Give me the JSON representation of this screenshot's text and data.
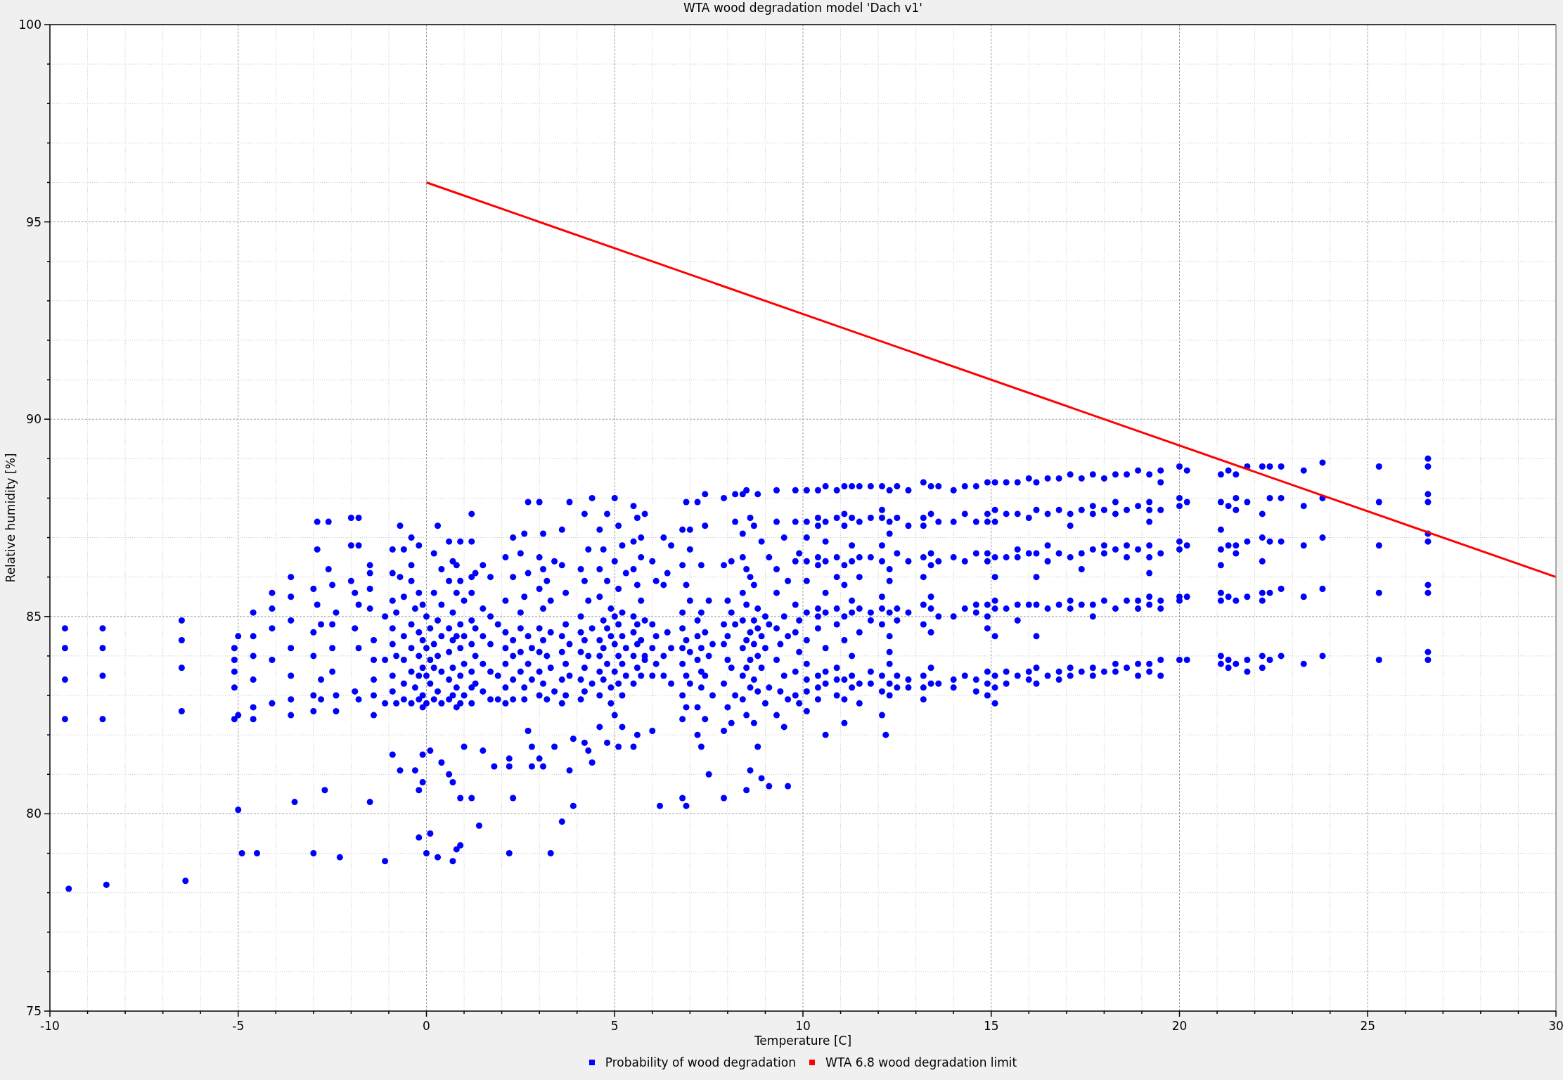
{
  "chart": {
    "chart_data": {
      "type": "scatter",
      "title": "WTA wood degradation model 'Dach v1'",
      "xlabel": "Temperature [C]",
      "ylabel": "Relative humidity [%]",
      "xlim": [
        -10,
        30
      ],
      "ylim": [
        75,
        100
      ],
      "xticks": [
        -10,
        -5,
        0,
        5,
        10,
        15,
        20,
        25,
        30
      ],
      "yticks": [
        75,
        80,
        85,
        90,
        95,
        100
      ],
      "grid": true,
      "series": [
        {
          "name": "Probability of wood degradation",
          "color": "#0000ff",
          "type": "scatter",
          "x": [
            -9.6,
            -9.6,
            -9.6,
            -9.6,
            -9.5,
            -8.6,
            -8.6,
            -8.6,
            -8.6,
            -8.5,
            -6.5,
            -6.5,
            -6.5,
            -6.5,
            -6.4,
            -5.1,
            -5.1,
            -5.1,
            -5.1,
            -5.1,
            -5.0,
            -5.0,
            -5.0,
            -4.9,
            -4.6,
            -4.6,
            -4.6,
            -4.6,
            -4.6,
            -4.6,
            -4.5,
            -4.1,
            -4.1,
            -4.1,
            -4.1,
            -4.1,
            -3.6,
            -3.6,
            -3.6,
            -3.6,
            -3.6,
            -3.6,
            -3.6,
            -3.5,
            -3.0,
            -3.0,
            -3.0,
            -3.0,
            -3.0,
            -3.0,
            -2.9,
            -2.9,
            -2.9,
            -2.8,
            -2.8,
            -2.8,
            -2.7,
            -2.6,
            -2.6,
            -2.5,
            -2.5,
            -2.5,
            -2.5,
            -2.4,
            -2.4,
            -2.4,
            -2.3,
            -2.0,
            -2.0,
            -2.0,
            -1.9,
            -1.9,
            -1.9,
            -1.8,
            -1.8,
            -1.8,
            -1.8,
            -1.8,
            -1.5,
            -1.5,
            -1.5,
            -1.5,
            -1.4,
            -1.4,
            -1.4,
            -1.4,
            -1.4,
            -1.5,
            -1.1,
            -1.1,
            -1.1,
            -1.1,
            -0.9,
            -0.9,
            -0.9,
            -0.9,
            -0.9,
            -0.9,
            -0.9,
            -0.9,
            -0.8,
            -0.8,
            -0.8,
            -0.7,
            -0.7,
            -0.7,
            -0.6,
            -0.6,
            -0.6,
            -0.6,
            -0.6,
            -0.6,
            -0.4,
            -0.4,
            -0.4,
            -0.4,
            -0.4,
            -0.4,
            -0.4,
            -0.3,
            -0.3,
            -0.3,
            -0.2,
            -0.2,
            -0.2,
            -0.2,
            -0.2,
            -0.2,
            -0.2,
            -0.2,
            -0.1,
            -0.1,
            -0.1,
            -0.1,
            -0.1,
            -0.1,
            -0.1,
            0.0,
            0.0,
            0.0,
            0.0,
            0.0,
            0.1,
            0.1,
            0.1,
            0.1,
            0.1,
            0.2,
            0.2,
            0.2,
            0.2,
            0.2,
            0.3,
            0.3,
            0.3,
            0.3,
            0.3,
            0.4,
            0.4,
            0.4,
            0.4,
            0.4,
            0.4,
            0.6,
            0.6,
            0.6,
            0.6,
            0.6,
            0.6,
            0.6,
            0.7,
            0.7,
            0.7,
            0.7,
            0.7,
            0.7,
            0.7,
            0.8,
            0.8,
            0.8,
            0.8,
            0.8,
            0.8,
            0.9,
            0.9,
            0.9,
            0.9,
            0.9,
            0.9,
            0.9,
            0.9,
            1.0,
            1.0,
            1.0,
            1.0,
            1.0,
            1.2,
            1.2,
            1.2,
            1.2,
            1.2,
            1.2,
            1.2,
            1.2,
            1.2,
            1.2,
            1.3,
            1.3,
            1.3,
            1.3,
            1.5,
            1.5,
            1.5,
            1.5,
            1.5,
            1.5,
            1.4,
            1.7,
            1.7,
            1.7,
            1.7,
            1.7,
            1.8,
            1.9,
            1.9,
            1.9,
            2.1,
            2.1,
            2.1,
            2.1,
            2.1,
            2.1,
            2.1,
            2.2,
            2.2,
            2.2,
            2.3,
            2.3,
            2.3,
            2.3,
            2.3,
            2.3,
            2.3,
            2.5,
            2.5,
            2.5,
            2.5,
            2.5,
            2.6,
            2.6,
            2.6,
            2.6,
            2.7,
            2.7,
            2.7,
            2.7,
            2.7,
            2.8,
            2.8,
            2.8,
            2.8,
            3.0,
            3.0,
            3.0,
            3.0,
            3.0,
            3.0,
            3.0,
            3.0,
            3.1,
            3.1,
            3.1,
            3.1,
            3.1,
            3.1,
            3.2,
            3.2,
            3.2,
            3.3,
            3.3,
            3.3,
            3.3,
            3.4,
            3.4,
            3.4,
            3.6,
            3.6,
            3.6,
            3.6,
            3.6,
            3.6,
            3.6,
            3.7,
            3.7,
            3.7,
            3.7,
            3.8,
            3.8,
            3.8,
            3.8,
            3.9,
            3.9,
            4.1,
            4.1,
            4.1,
            4.1,
            4.1,
            4.1,
            4.2,
            4.2,
            4.2,
            4.2,
            4.2,
            4.2,
            4.3,
            4.3,
            4.3,
            4.3,
            4.4,
            4.4,
            4.4,
            4.4,
            4.6,
            4.6,
            4.6,
            4.6,
            4.6,
            4.6,
            4.6,
            4.6,
            4.7,
            4.7,
            4.7,
            4.7,
            4.8,
            4.8,
            4.8,
            4.8,
            4.8,
            4.9,
            4.9,
            4.9,
            4.9,
            5.0,
            5.0,
            5.0,
            5.0,
            5.0,
            5.0,
            5.1,
            5.1,
            5.1,
            5.1,
            5.1,
            5.1,
            5.2,
            5.2,
            5.2,
            5.2,
            5.2,
            5.2,
            5.3,
            5.3,
            5.3,
            5.5,
            5.5,
            5.5,
            5.5,
            5.5,
            5.5,
            5.5,
            5.5,
            5.6,
            5.6,
            5.6,
            5.6,
            5.6,
            5.6,
            5.7,
            5.7,
            5.7,
            5.7,
            5.7,
            5.8,
            5.8,
            5.8,
            5.8,
            6.0,
            6.0,
            6.0,
            6.0,
            6.0,
            6.1,
            6.1,
            6.1,
            6.2,
            6.3,
            6.3,
            6.3,
            6.3,
            6.4,
            6.4,
            6.5,
            6.5,
            6.5,
            6.8,
            6.8,
            6.8,
            6.8,
            6.8,
            6.8,
            6.8,
            6.8,
            6.8,
            6.9,
            6.9,
            6.9,
            6.9,
            6.9,
            6.9,
            7.0,
            7.0,
            7.0,
            7.0,
            7.0,
            7.2,
            7.2,
            7.2,
            7.2,
            7.2,
            7.2,
            7.3,
            7.3,
            7.3,
            7.3,
            7.3,
            7.3,
            7.4,
            7.4,
            7.4,
            7.4,
            7.4,
            7.5,
            7.5,
            7.5,
            7.6,
            7.6,
            7.9,
            7.9,
            7.9,
            7.9,
            7.9,
            7.9,
            7.9,
            8.0,
            8.0,
            8.0,
            8.0,
            8.1,
            8.1,
            8.1,
            8.1,
            8.2,
            8.2,
            8.2,
            8.2,
            8.4,
            8.4,
            8.4,
            8.4,
            8.4,
            8.4,
            8.4,
            8.4,
            8.5,
            8.5,
            8.5,
            8.5,
            8.5,
            8.5,
            8.5,
            8.6,
            8.6,
            8.6,
            8.6,
            8.6,
            8.6,
            8.7,
            8.7,
            8.7,
            8.7,
            8.7,
            8.7,
            8.8,
            8.8,
            8.8,
            8.8,
            8.8,
            8.8,
            8.9,
            8.9,
            8.9,
            8.9,
            9.0,
            9.0,
            9.0,
            9.1,
            9.1,
            9.1,
            9.1,
            9.3,
            9.3,
            9.3,
            9.3,
            9.3,
            9.3,
            9.3,
            9.4,
            9.4,
            9.5,
            9.5,
            9.5,
            9.5,
            9.6,
            9.6,
            9.6,
            9.6,
            9.8,
            9.8,
            9.8,
            9.8,
            9.8,
            9.8,
            9.8,
            9.9,
            9.9,
            9.9,
            9.9,
            10.1,
            10.1,
            10.1,
            10.1,
            10.1,
            10.1,
            10.1,
            10.1,
            10.1,
            10.1,
            10.1,
            10.4,
            10.4,
            10.4,
            10.4,
            10.4,
            10.4,
            10.4,
            10.4,
            10.4,
            10.4,
            10.4,
            10.6,
            10.6,
            10.6,
            10.6,
            10.6,
            10.6,
            10.6,
            10.6,
            10.6,
            10.6,
            10.9,
            10.9,
            10.9,
            10.9,
            10.9,
            10.9,
            10.9,
            10.9,
            10.9,
            11.1,
            11.1,
            11.1,
            11.1,
            11.1,
            11.1,
            11.1,
            11.1,
            11.1,
            11.1,
            11.3,
            11.3,
            11.3,
            11.3,
            11.3,
            11.3,
            11.3,
            11.3,
            11.3,
            11.5,
            11.5,
            11.5,
            11.5,
            11.5,
            11.5,
            11.5,
            11.5,
            11.8,
            11.8,
            11.8,
            11.8,
            11.8,
            11.8,
            11.8,
            12.1,
            12.1,
            12.1,
            12.1,
            12.1,
            12.1,
            12.1,
            12.1,
            12.1,
            12.1,
            12.1,
            12.3,
            12.3,
            12.3,
            12.3,
            12.3,
            12.3,
            12.3,
            12.3,
            12.3,
            12.3,
            12.3,
            12.2,
            12.5,
            12.5,
            12.5,
            12.5,
            12.5,
            12.5,
            12.5,
            12.8,
            12.8,
            12.8,
            12.8,
            12.8,
            12.8,
            13.2,
            13.2,
            13.2,
            13.2,
            13.2,
            13.2,
            13.2,
            13.2,
            13.2,
            13.2,
            13.4,
            13.4,
            13.4,
            13.4,
            13.4,
            13.4,
            13.4,
            13.4,
            13.4,
            13.6,
            13.6,
            13.6,
            13.6,
            13.6,
            14.0,
            14.0,
            14.0,
            14.0,
            14.0,
            14.0,
            14.3,
            14.3,
            14.3,
            14.3,
            14.3,
            14.6,
            14.6,
            14.6,
            14.6,
            14.6,
            14.6,
            14.6,
            14.9,
            14.9,
            14.9,
            14.9,
            14.9,
            14.9,
            14.9,
            14.9,
            14.9,
            14.9,
            14.9,
            15.1,
            15.1,
            15.1,
            15.1,
            15.1,
            15.1,
            15.1,
            15.1,
            15.1,
            15.1,
            15.1,
            15.4,
            15.4,
            15.4,
            15.4,
            15.4,
            15.4,
            15.7,
            15.7,
            15.7,
            15.7,
            15.7,
            15.7,
            15.7,
            16.0,
            16.0,
            16.0,
            16.0,
            16.0,
            16.0,
            16.2,
            16.2,
            16.2,
            16.2,
            16.2,
            16.2,
            16.2,
            16.2,
            16.5,
            16.5,
            16.5,
            16.5,
            16.5,
            16.5,
            16.8,
            16.8,
            16.8,
            16.8,
            16.8,
            16.8,
            17.1,
            17.1,
            17.1,
            17.1,
            17.1,
            17.1,
            17.1,
            17.1,
            17.4,
            17.4,
            17.4,
            17.4,
            17.4,
            17.4,
            17.7,
            17.7,
            17.7,
            17.7,
            17.7,
            17.7,
            17.7,
            17.7,
            18.0,
            18.0,
            18.0,
            18.0,
            18.0,
            18.0,
            18.3,
            18.3,
            18.3,
            18.3,
            18.3,
            18.3,
            18.3,
            18.6,
            18.6,
            18.6,
            18.6,
            18.6,
            18.6,
            18.9,
            18.9,
            18.9,
            18.9,
            18.9,
            18.9,
            18.9,
            19.2,
            19.2,
            19.2,
            19.2,
            19.2,
            19.2,
            19.2,
            19.2,
            19.2,
            19.2,
            19.2,
            19.5,
            19.5,
            19.5,
            19.5,
            19.5,
            19.5,
            19.5,
            19.5,
            20.0,
            20.0,
            20.0,
            20.0,
            20.0,
            20.0,
            20.0,
            20.0,
            20.2,
            20.2,
            20.2,
            20.2,
            20.2,
            21.1,
            21.1,
            21.1,
            21.1,
            21.1,
            21.1,
            21.1,
            21.1,
            21.1,
            21.3,
            21.3,
            21.3,
            21.3,
            21.3,
            21.3,
            21.5,
            21.5,
            21.5,
            21.5,
            21.5,
            21.5,
            21.5,
            21.8,
            21.8,
            21.8,
            21.8,
            21.8,
            21.8,
            22.2,
            22.2,
            22.2,
            22.2,
            22.2,
            22.2,
            22.2,
            22.2,
            22.4,
            22.4,
            22.4,
            22.4,
            22.4,
            22.7,
            22.7,
            22.7,
            22.7,
            22.7,
            23.3,
            23.3,
            23.3,
            23.3,
            23.3,
            23.8,
            23.8,
            23.8,
            23.8,
            23.8,
            25.3,
            25.3,
            25.3,
            25.3,
            25.3,
            26.6,
            26.6,
            26.6,
            26.6,
            26.6,
            26.6,
            26.6,
            26.6,
            26.6,
            26.6
          ],
          "values": [
            84.7,
            84.2,
            83.4,
            82.4,
            78.1,
            84.7,
            84.2,
            83.5,
            82.4,
            78.2,
            84.9,
            84.4,
            83.7,
            82.6,
            78.3,
            84.2,
            83.9,
            83.6,
            83.2,
            82.4,
            84.5,
            82.5,
            80.1,
            79.0,
            85.1,
            84.5,
            84.0,
            83.4,
            82.7,
            82.4,
            79.0,
            85.6,
            85.2,
            84.7,
            83.9,
            82.8,
            86.0,
            85.5,
            84.9,
            84.2,
            83.5,
            82.9,
            82.5,
            80.3,
            85.7,
            84.6,
            84.0,
            83.0,
            82.6,
            79.0,
            87.4,
            86.7,
            85.3,
            84.8,
            83.4,
            82.9,
            80.6,
            87.4,
            86.2,
            85.8,
            84.8,
            84.2,
            83.6,
            85.1,
            83.0,
            82.6,
            78.9,
            87.5,
            86.8,
            85.9,
            85.6,
            84.7,
            83.1,
            87.5,
            86.8,
            85.3,
            84.2,
            82.9,
            86.3,
            86.1,
            85.7,
            85.2,
            84.4,
            83.9,
            83.4,
            83.0,
            82.5,
            80.3,
            85.0,
            83.9,
            82.8,
            78.8,
            86.7,
            86.1,
            85.4,
            84.7,
            84.3,
            83.5,
            83.1,
            81.5,
            85.1,
            84.0,
            82.8,
            87.3,
            86.0,
            81.1,
            86.7,
            85.5,
            84.5,
            83.9,
            83.3,
            82.9,
            87.0,
            86.3,
            85.9,
            84.8,
            84.2,
            83.6,
            82.8,
            85.2,
            83.2,
            81.1,
            86.8,
            85.6,
            84.6,
            84.0,
            83.5,
            82.9,
            80.6,
            79.4,
            85.3,
            84.4,
            83.7,
            83.0,
            82.7,
            81.5,
            80.8,
            85.0,
            84.2,
            83.5,
            82.8,
            79.0,
            84.7,
            83.9,
            83.3,
            81.6,
            79.5,
            86.6,
            85.6,
            84.3,
            83.7,
            82.9,
            87.3,
            84.9,
            84.0,
            83.1,
            78.9,
            86.2,
            85.3,
            84.5,
            83.6,
            82.8,
            81.3,
            86.9,
            85.9,
            84.7,
            84.1,
            83.4,
            82.9,
            81.0,
            86.4,
            85.1,
            84.4,
            83.7,
            83.0,
            80.8,
            78.8,
            86.3,
            85.6,
            84.5,
            83.2,
            82.7,
            79.1,
            86.9,
            85.9,
            84.8,
            84.2,
            83.5,
            82.8,
            80.4,
            79.2,
            85.4,
            84.5,
            83.8,
            83.0,
            81.7,
            87.6,
            86.9,
            86.0,
            85.6,
            84.9,
            84.3,
            83.6,
            83.2,
            82.8,
            80.4,
            86.1,
            84.7,
            84.0,
            83.3,
            86.3,
            85.2,
            84.5,
            83.8,
            83.1,
            81.6,
            79.7,
            86.0,
            85.0,
            84.3,
            83.6,
            82.9,
            81.2,
            84.8,
            83.5,
            82.9,
            86.5,
            85.4,
            84.6,
            84.2,
            83.8,
            83.2,
            82.8,
            81.4,
            81.2,
            79.0,
            87.0,
            86.0,
            84.4,
            84.0,
            83.4,
            82.9,
            80.4,
            86.6,
            85.1,
            84.7,
            84.1,
            83.6,
            87.1,
            85.5,
            83.2,
            82.9,
            87.9,
            86.1,
            84.5,
            83.8,
            82.1,
            84.2,
            83.4,
            81.7,
            81.2,
            87.9,
            86.5,
            85.7,
            84.7,
            84.1,
            83.6,
            83.0,
            81.4,
            87.1,
            86.2,
            85.2,
            84.4,
            83.3,
            81.2,
            85.9,
            84.0,
            82.9,
            85.4,
            84.6,
            83.7,
            79.0,
            86.4,
            83.1,
            81.7,
            87.2,
            86.3,
            84.5,
            84.1,
            83.4,
            82.8,
            79.8,
            85.6,
            84.8,
            83.8,
            83.0,
            87.9,
            84.3,
            83.5,
            81.1,
            80.2,
            81.9,
            86.2,
            85.0,
            84.6,
            84.1,
            83.4,
            82.9,
            87.6,
            85.9,
            84.4,
            83.7,
            83.1,
            81.8,
            86.7,
            85.4,
            84.0,
            81.6,
            88.0,
            84.7,
            83.3,
            81.3,
            87.2,
            86.2,
            85.5,
            84.4,
            84.0,
            83.6,
            83.0,
            82.2,
            86.7,
            84.9,
            84.2,
            83.4,
            87.6,
            85.9,
            84.7,
            83.8,
            81.8,
            85.2,
            84.5,
            83.2,
            82.8,
            88.0,
            86.4,
            85.0,
            84.3,
            83.6,
            82.5,
            87.3,
            85.7,
            84.8,
            84.0,
            83.3,
            81.7,
            86.8,
            85.1,
            84.5,
            83.8,
            83.0,
            82.2,
            86.1,
            84.2,
            83.5,
            87.8,
            86.9,
            86.2,
            85.0,
            84.6,
            84.0,
            83.3,
            81.7,
            87.5,
            85.8,
            84.8,
            84.3,
            83.7,
            82.0,
            87.0,
            86.5,
            85.4,
            84.4,
            83.5,
            87.6,
            84.9,
            84.0,
            83.9,
            86.4,
            84.8,
            84.2,
            83.5,
            82.1,
            85.9,
            84.5,
            83.8,
            80.2,
            87.0,
            85.8,
            84.0,
            83.5,
            86.1,
            84.6,
            86.8,
            84.2,
            83.3,
            87.2,
            86.3,
            85.1,
            84.7,
            84.2,
            83.8,
            83.0,
            82.4,
            80.4,
            87.9,
            85.8,
            84.4,
            83.5,
            82.7,
            80.2,
            87.2,
            86.7,
            85.4,
            84.1,
            83.3,
            87.9,
            84.9,
            84.5,
            83.9,
            82.7,
            82.0,
            86.3,
            85.1,
            84.2,
            83.6,
            83.2,
            81.7,
            88.1,
            87.3,
            84.6,
            83.5,
            82.4,
            85.4,
            84.0,
            81.0,
            84.3,
            83.0,
            88.0,
            86.3,
            84.8,
            84.3,
            83.3,
            82.1,
            80.4,
            85.4,
            84.5,
            83.9,
            82.7,
            86.4,
            85.1,
            83.7,
            82.3,
            88.1,
            87.4,
            84.8,
            83.0,
            88.1,
            87.1,
            86.5,
            85.6,
            84.9,
            84.2,
            83.5,
            82.9,
            88.2,
            86.2,
            85.3,
            84.4,
            83.7,
            82.5,
            80.6,
            87.5,
            86.0,
            84.6,
            83.9,
            83.2,
            81.1,
            87.3,
            85.8,
            84.9,
            84.3,
            83.4,
            82.3,
            88.1,
            85.2,
            84.7,
            84.0,
            83.1,
            81.7,
            86.9,
            84.5,
            83.7,
            80.9,
            85.0,
            84.2,
            82.8,
            86.5,
            84.8,
            83.2,
            80.7,
            88.2,
            87.4,
            86.2,
            85.6,
            84.7,
            83.9,
            82.5,
            84.3,
            83.1,
            87.0,
            85.0,
            83.5,
            82.2,
            85.9,
            84.5,
            82.9,
            80.7,
            88.2,
            87.4,
            86.4,
            85.3,
            84.6,
            83.6,
            83.0,
            86.6,
            84.9,
            84.1,
            82.8,
            88.2,
            87.4,
            87.0,
            86.4,
            85.9,
            85.1,
            84.4,
            83.8,
            83.4,
            83.1,
            82.6,
            88.2,
            87.5,
            87.3,
            86.5,
            86.3,
            85.2,
            85.0,
            84.7,
            83.5,
            83.2,
            82.9,
            88.3,
            87.4,
            86.9,
            86.4,
            85.6,
            85.1,
            84.2,
            83.6,
            83.3,
            82.0,
            88.2,
            87.5,
            86.5,
            86.0,
            85.2,
            84.8,
            83.7,
            83.4,
            83.0,
            88.3,
            87.6,
            87.3,
            86.3,
            85.8,
            85.0,
            84.4,
            83.4,
            82.9,
            82.3,
            88.3,
            87.5,
            86.8,
            86.4,
            85.4,
            85.1,
            84.0,
            83.5,
            83.2,
            88.3,
            87.4,
            86.5,
            86.0,
            85.2,
            84.6,
            83.3,
            82.8,
            88.3,
            87.5,
            86.5,
            85.1,
            84.9,
            83.6,
            83.3,
            88.3,
            87.7,
            87.5,
            86.8,
            86.4,
            85.5,
            85.2,
            84.8,
            83.5,
            83.1,
            82.5,
            88.2,
            87.4,
            87.1,
            86.2,
            85.9,
            85.1,
            84.5,
            84.1,
            83.8,
            83.3,
            83.0,
            82.0,
            88.3,
            87.5,
            86.6,
            85.2,
            84.9,
            83.5,
            83.2,
            88.2,
            87.3,
            86.4,
            85.1,
            83.4,
            83.2,
            88.4,
            87.5,
            87.3,
            86.5,
            86.0,
            85.3,
            84.8,
            83.5,
            83.2,
            82.9,
            88.3,
            87.6,
            86.6,
            86.3,
            85.5,
            85.2,
            84.6,
            83.7,
            83.3,
            88.3,
            87.4,
            86.4,
            85.0,
            83.3,
            88.2,
            87.4,
            86.5,
            85.0,
            83.4,
            83.2,
            88.3,
            87.6,
            86.4,
            85.2,
            83.5,
            88.3,
            87.4,
            86.6,
            85.3,
            85.1,
            83.4,
            83.1,
            88.4,
            87.6,
            87.4,
            86.6,
            86.4,
            85.3,
            85.0,
            84.7,
            83.6,
            83.3,
            83.0,
            88.4,
            87.7,
            87.4,
            86.5,
            86.0,
            85.4,
            85.2,
            84.5,
            83.5,
            83.2,
            82.8,
            88.4,
            87.6,
            86.5,
            85.2,
            83.6,
            83.3,
            88.4,
            87.6,
            86.7,
            86.5,
            85.3,
            84.9,
            83.5,
            88.5,
            87.5,
            86.6,
            85.3,
            83.6,
            83.4,
            88.4,
            87.7,
            86.6,
            86.0,
            85.3,
            84.5,
            83.7,
            83.3,
            88.5,
            87.6,
            86.8,
            86.4,
            85.2,
            83.5,
            88.5,
            87.7,
            86.6,
            85.3,
            83.6,
            83.4,
            88.6,
            87.6,
            87.3,
            86.5,
            85.4,
            85.2,
            83.7,
            83.5,
            88.5,
            87.7,
            86.6,
            86.2,
            85.3,
            83.6,
            88.6,
            87.8,
            87.6,
            86.7,
            85.3,
            85.0,
            83.7,
            83.5,
            88.5,
            87.7,
            86.8,
            86.6,
            85.4,
            83.6,
            88.6,
            87.9,
            87.6,
            86.7,
            85.2,
            83.8,
            83.6,
            88.6,
            87.7,
            86.8,
            86.5,
            85.4,
            83.7,
            88.7,
            87.8,
            86.7,
            85.4,
            85.2,
            83.8,
            83.5,
            88.6,
            87.9,
            87.7,
            87.4,
            86.8,
            86.5,
            86.1,
            85.5,
            85.3,
            83.8,
            83.6,
            88.7,
            88.4,
            87.7,
            86.6,
            85.4,
            85.2,
            83.9,
            83.5,
            88.8,
            88.0,
            87.8,
            86.9,
            86.7,
            85.5,
            85.4,
            83.9,
            88.7,
            87.9,
            86.8,
            85.5,
            83.9,
            88.6,
            87.9,
            87.2,
            86.7,
            86.3,
            85.6,
            85.4,
            84.0,
            83.8,
            88.7,
            87.8,
            86.8,
            85.5,
            83.9,
            83.7,
            88.6,
            88.0,
            87.7,
            86.8,
            86.6,
            85.4,
            83.8,
            88.8,
            87.9,
            86.9,
            85.5,
            83.9,
            83.6,
            88.8,
            87.6,
            87.0,
            86.4,
            85.6,
            85.4,
            84.0,
            83.7,
            88.8,
            88.0,
            86.9,
            85.6,
            83.9,
            88.8,
            88.0,
            86.9,
            85.7,
            84.0,
            88.7,
            87.8,
            86.8,
            85.5,
            83.8,
            88.9,
            88.0,
            87.0,
            85.7,
            84.0,
            88.8,
            87.9,
            86.8,
            85.6,
            83.9,
            89.0,
            88.8,
            88.1,
            87.9,
            87.1,
            86.9,
            85.8,
            85.6,
            84.1,
            83.9
          ]
        },
        {
          "name": "WTA 6.8 wood degradation limit",
          "color": "#ff0000",
          "type": "line",
          "x": [
            0,
            30
          ],
          "values": [
            96,
            86
          ]
        }
      ]
    }
  }
}
